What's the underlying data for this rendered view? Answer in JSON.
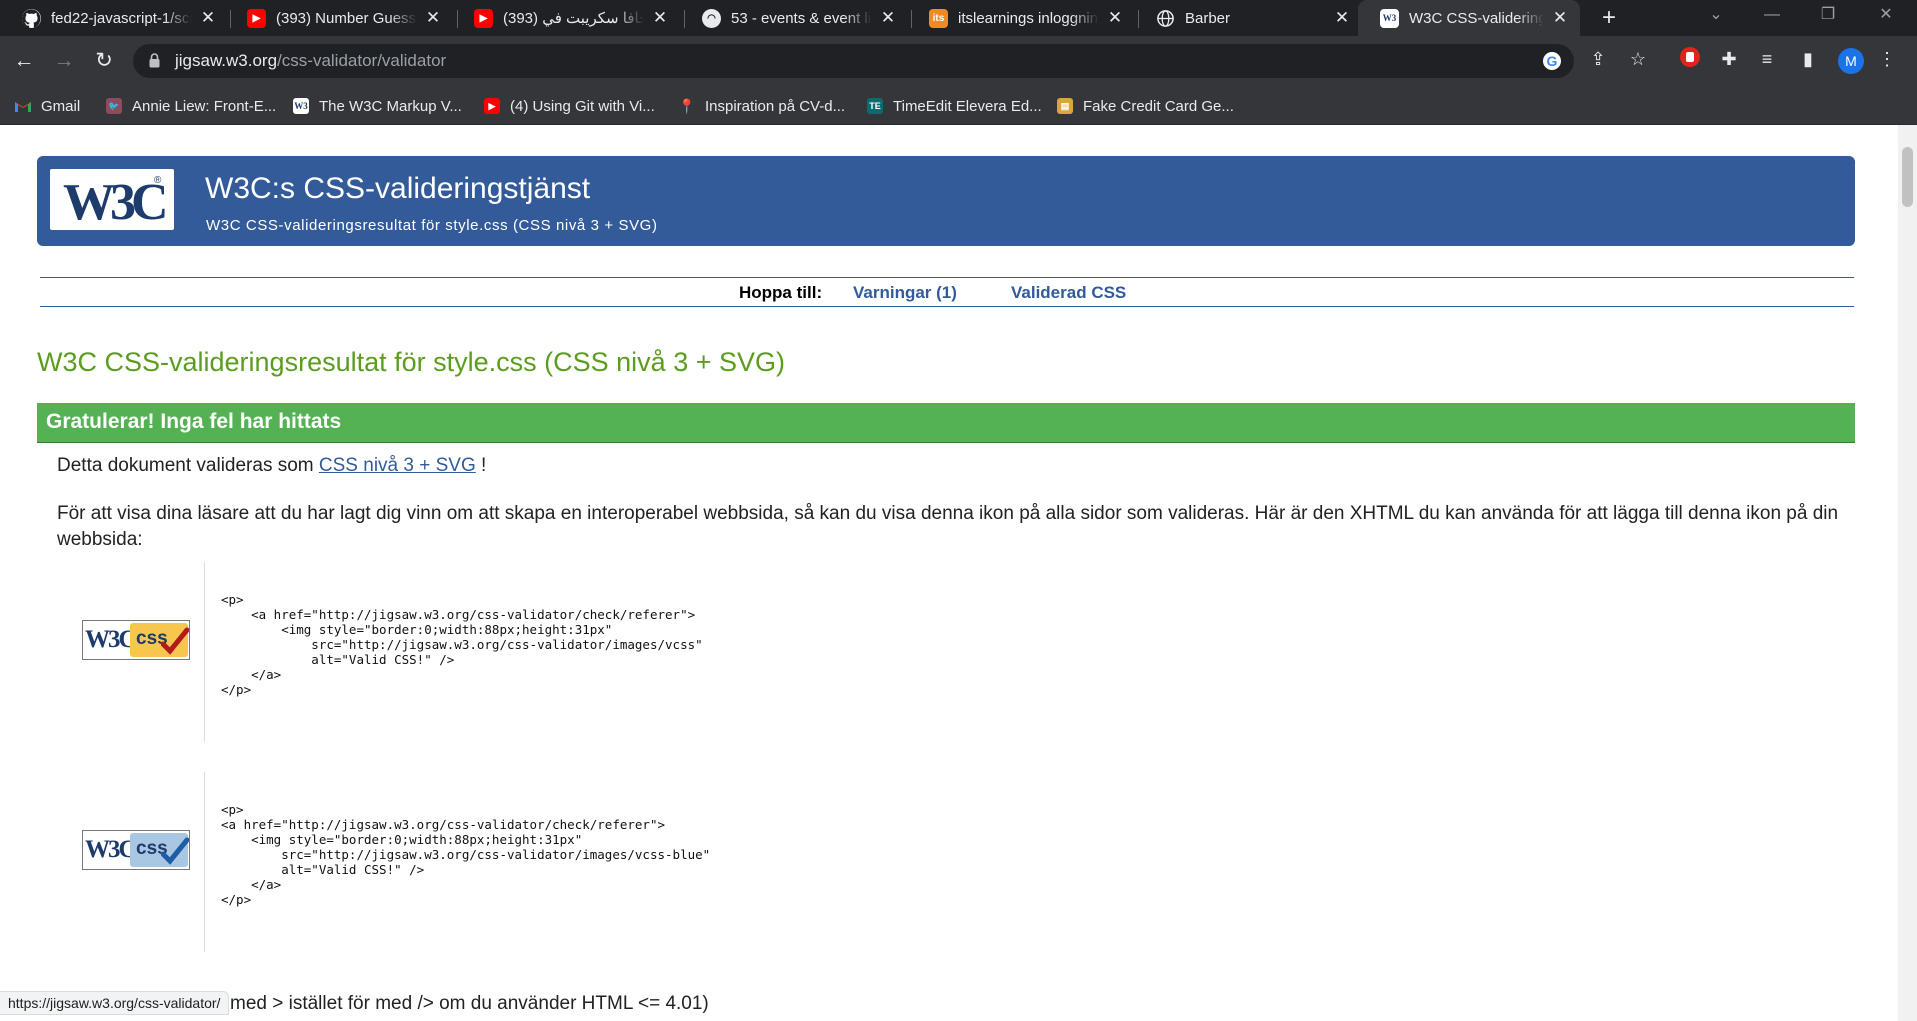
{
  "tabs": [
    {
      "title": "fed22-javascript-1/scr",
      "icon": "github-icon"
    },
    {
      "title": "(393) Number Guessin",
      "icon": "youtube-icon"
    },
    {
      "title": "جافا سكريبت في (393)",
      "icon": "youtube-icon"
    },
    {
      "title": "53 - events & event lis",
      "icon": "ninja-icon"
    },
    {
      "title": "itslearnings inloggning",
      "icon": "itslearning-icon"
    },
    {
      "title": "Barber",
      "icon": "globe-icon"
    },
    {
      "title": "W3C CSS-valideringsre",
      "icon": "w3c-icon"
    }
  ],
  "address": {
    "domain": "jigsaw.w3.org",
    "path": "/css-validator/validator"
  },
  "profile_initial": "M",
  "bookmarks": [
    {
      "label": "Gmail",
      "icon": "gmail-icon"
    },
    {
      "label": "Annie Liew: Front-E...",
      "icon": "bird-icon"
    },
    {
      "label": "The W3C Markup V...",
      "icon": "w3c-icon"
    },
    {
      "label": "(4) Using Git with Vi...",
      "icon": "youtube-icon"
    },
    {
      "label": "Inspiration på CV-d...",
      "icon": "pin-icon"
    },
    {
      "label": "TimeEdit Elevera Ed...",
      "icon": "timeedit-icon"
    },
    {
      "label": "Fake Credit Card Ge...",
      "icon": "card-icon"
    }
  ],
  "banner": {
    "title": "W3C:s CSS-valideringstjänst",
    "subtitle": "W3C CSS-valideringsresultat för style.css (CSS nivå 3 + SVG)"
  },
  "jump": {
    "label": "Hoppa till:",
    "warnings": "Varningar (1)",
    "validated": "Validerad CSS"
  },
  "result_title": "W3C CSS-valideringsresultat för style.css (CSS nivå 3 + SVG)",
  "success_banner": "Gratulerar! Inga fel har hittats",
  "validated_as": {
    "prefix": "Detta dokument valideras som",
    "link": "CSS nivå 3 + SVG",
    "suffix": "!"
  },
  "icon_text": "För att visa dina läsare att du har lagt dig vinn om att skapa en interoperabel webbsida, så kan du visa denna ikon på alla sidor som valideras. Här är den XHTML du kan använda för att lägga till denna ikon på din webbsida:",
  "snippets": [
    {
      "badge_label": "css",
      "color": "#f6c64f",
      "check_color": "#b31b1b",
      "code": "<p>\n    <a href=\"http://jigsaw.w3.org/css-validator/check/referer\">\n        <img style=\"border:0;width:88px;height:31px\"\n            src=\"http://jigsaw.w3.org/css-validator/images/vcss\"\n            alt=\"Valid CSS!\" />\n    </a>\n</p>"
    },
    {
      "badge_label": "css",
      "color": "#a9c6e3",
      "check_color": "#1d5da5",
      "code": "<p>\n<a href=\"http://jigsaw.w3.org/css-validator/check/referer\">\n    <img style=\"border:0;width:88px;height:31px\"\n        src=\"http://jigsaw.w3.org/css-validator/images/vcss-blue\"\n        alt=\"Valid CSS!\" />\n    </a>\n</p>"
    }
  ],
  "html_note": "med > istället för med /> om du använder HTML <= 4.01)",
  "status_url": "https://jigsaw.w3.org/css-validator/"
}
